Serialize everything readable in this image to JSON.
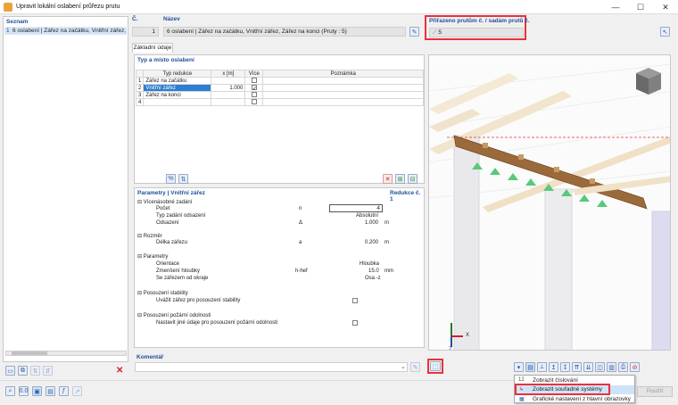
{
  "window": {
    "title": "Upravit lokální oslabení průřezu prutu",
    "minimize": "—",
    "maximize": "☐",
    "close": "✕"
  },
  "list": {
    "header": "Seznam",
    "items": [
      {
        "number": "1",
        "label": "6 oslabení | Zářez na začátku, Vnitřní zářez, Zá"
      }
    ]
  },
  "top": {
    "number_header": "Č.",
    "number_value": "1",
    "name_header": "Název",
    "name_value": "6 oslabení | Zářez na začátku, Vnitřní zářez, Zářez na konci (Pruty : 5)",
    "assigned_header": "Přiřazeno prutům č. / sadám prutů č.",
    "assigned_value": "5"
  },
  "tabs": [
    "Základní údaje"
  ],
  "type_section": {
    "title": "Typ a místo oslabení",
    "columns": [
      "Typ redukce",
      "x [m]",
      "Více",
      "Poznámka"
    ],
    "rows": [
      {
        "no": "1",
        "type": "Zářez na začátku",
        "x": "",
        "more": false
      },
      {
        "no": "2",
        "type": "Vnitřní zářez",
        "x": "1.000",
        "more": true
      },
      {
        "no": "3",
        "type": "Zářez na konci",
        "x": "",
        "more": false
      },
      {
        "no": "4",
        "type": "",
        "x": "",
        "more": false
      }
    ]
  },
  "params": {
    "title": "Parametry | Vnitřní zářez",
    "right_title": "Redukce č. 1",
    "groups": [
      {
        "name": "Vícenásobné zadání",
        "rows": [
          {
            "label": "Počet",
            "symbol": "n",
            "value": "4",
            "unit": ""
          },
          {
            "label": "Typ zadání odsazení",
            "symbol": "",
            "value": "Absolutní",
            "unit": ""
          },
          {
            "label": "Odsazení",
            "symbol": "Δ",
            "value": "1.000",
            "unit": "m"
          }
        ]
      },
      {
        "name": "Rozměr",
        "rows": [
          {
            "label": "Délka zářezu",
            "symbol": "a",
            "value": "0.200",
            "unit": "m"
          }
        ]
      },
      {
        "name": "Parametry",
        "rows": [
          {
            "label": "Orientace",
            "symbol": "",
            "value": "Hloubka",
            "unit": ""
          },
          {
            "label": "Zmenšení hloubky",
            "symbol": "h-hef",
            "value": "15.0",
            "unit": "mm"
          },
          {
            "label": "Se zářezem od okraje",
            "symbol": "",
            "value": "Osa -z",
            "unit": ""
          }
        ]
      },
      {
        "name": "Posouzení stability",
        "rows": [
          {
            "label": "Uvážit zářez pro posouzení stability",
            "symbol": "",
            "value": "",
            "unit": ""
          }
        ]
      },
      {
        "name": "Posouzení požární odolnosti",
        "rows": [
          {
            "label": "Nastavit jiné údaje pro posouzení požární odolnosti",
            "symbol": "",
            "value": "",
            "unit": ""
          }
        ]
      }
    ]
  },
  "comment": {
    "label": "Komentář"
  },
  "axes": {
    "x": "X",
    "z": "Z"
  },
  "context_menu": {
    "items": [
      {
        "label": "Zobrazit číslování",
        "icon": "numbering-icon"
      },
      {
        "label": "Zobrazit souřadné systémy",
        "icon": "coordinate-system-icon"
      },
      {
        "label": "Grafické nastavení z hlavní obrazovky",
        "icon": "graphics-settings-icon"
      }
    ]
  },
  "footer": {
    "apply": "Použít"
  },
  "colors": {
    "highlight_red": "#e8323c",
    "selection_blue": "#2c7fd4",
    "timber": "#9b6a3a",
    "support_green": "#58c97a"
  }
}
